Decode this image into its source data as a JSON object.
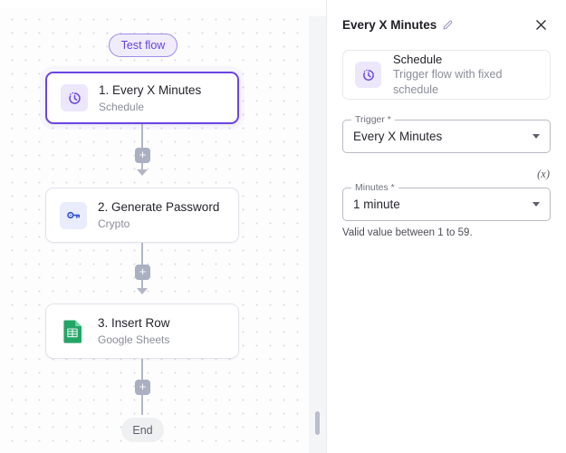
{
  "canvas": {
    "test_flow_label": "Test flow",
    "end_label": "End",
    "add_step_label": "+",
    "nodes": [
      {
        "title": "1. Every X Minutes",
        "subtitle": "Schedule",
        "icon": "clock-schedule-icon",
        "selected": true
      },
      {
        "title": "2. Generate Password",
        "subtitle": "Crypto",
        "icon": "key-icon",
        "selected": false
      },
      {
        "title": "3. Insert Row",
        "subtitle": "Google Sheets",
        "icon": "google-sheets-icon",
        "selected": false
      }
    ]
  },
  "panel": {
    "title": "Every X Minutes",
    "edit_icon": "pencil-icon",
    "close_icon": "close-icon",
    "info_card": {
      "title": "Schedule",
      "subtitle": "Trigger flow with fixed schedule",
      "icon": "clock-schedule-icon"
    },
    "fields": [
      {
        "label": "Trigger *",
        "value": "Every X Minutes",
        "icon": "chevron-down-icon"
      },
      {
        "label": "Minutes *",
        "value": "1 minute",
        "icon": "chevron-down-icon",
        "variable_icon": "(x)",
        "helper": "Valid value between 1 to 59."
      }
    ]
  },
  "colors": {
    "accent_purple": "#6c45e2",
    "pill_bg": "#f0ecfc",
    "connector_grey": "#b2b6c4",
    "sheets_green": "#21a366",
    "crypto_blue": "#2f4fd0"
  }
}
